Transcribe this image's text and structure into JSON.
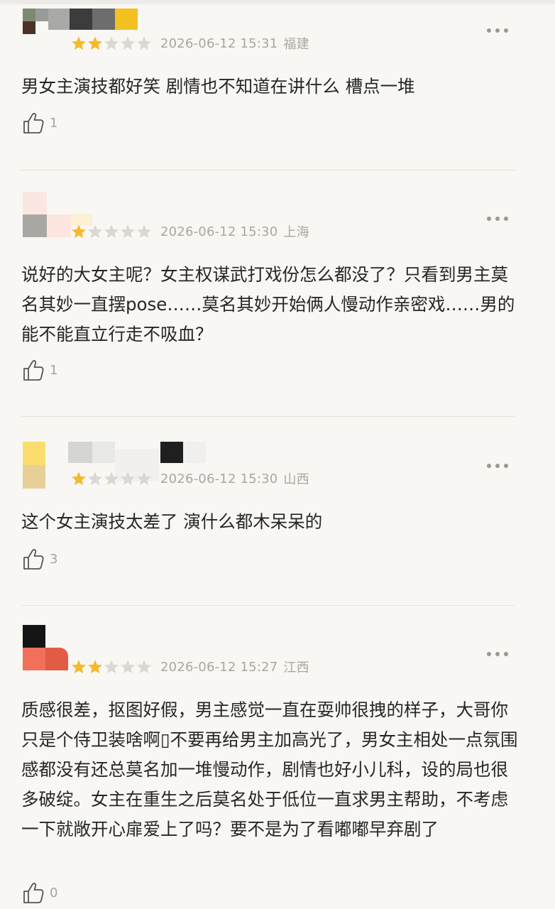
{
  "colors": {
    "star_on": "#f5b92b",
    "star_off": "#dad8d3",
    "meta_text": "#a9a7a2",
    "body_text": "#262626",
    "background": "#f8f7f3"
  },
  "icons": {
    "star": "star-icon",
    "more": "more-dots-icon",
    "like": "thumbs-up-icon"
  },
  "reviews": [
    {
      "rating": 2,
      "time": "2026-06-12 15:31",
      "location": "福建",
      "content": "男女主演技都好笑 剧情也不知道在讲什么 槽点一堆",
      "likes": "1"
    },
    {
      "rating": 1,
      "time": "2026-06-12 15:30",
      "location": "上海",
      "content": "说好的大女主呢？女主权谋武打戏份怎么都没了？只看到男主莫名其妙一直摆pose……莫名其妙开始俩人慢动作亲密戏……男的能不能直立行走不吸血？",
      "likes": "1"
    },
    {
      "rating": 1,
      "time": "2026-06-12 15:30",
      "location": "山西",
      "content": "这个女主演技太差了 演什么都木呆呆的",
      "likes": "3"
    },
    {
      "rating": 2,
      "time": "2026-06-12 15:27",
      "location": "江西",
      "content": "质感很差，抠图好假，男主感觉一直在耍帅很拽的样子，大哥你只是个侍卫装啥啊▯不要再给男主加高光了，男女主相处一点氛围感都没有还总莫名加一堆慢动作，剧情也好小儿科，设的局也很多破绽。女主在重生之后莫名处于低位一直求男主帮助，不考虑一下就敞开心扉爱上了吗？要不是为了看嘟嘟早弃剧了",
      "likes": "0"
    }
  ]
}
